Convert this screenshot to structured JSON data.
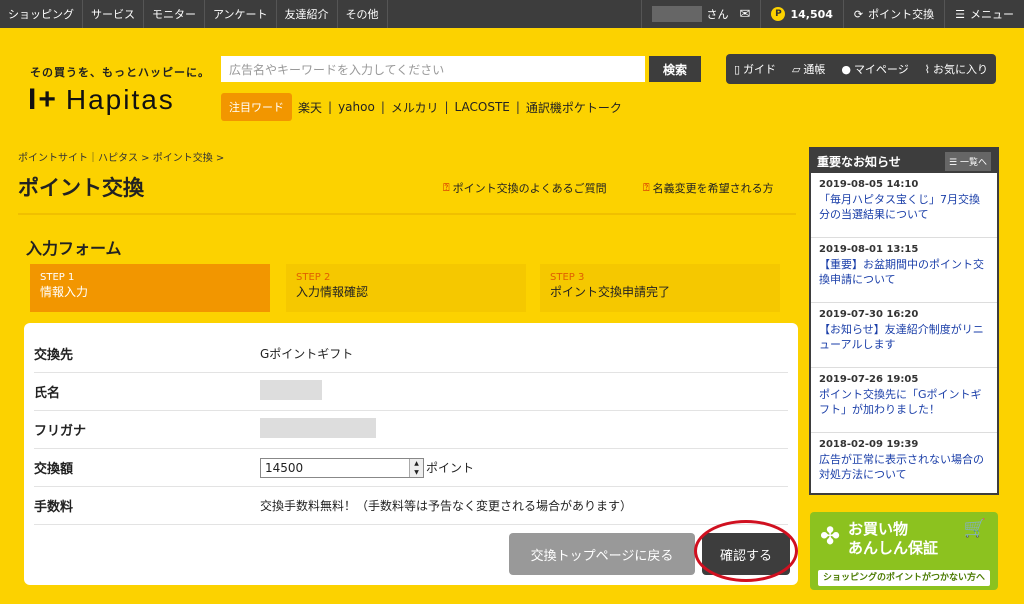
{
  "topnav": [
    "ショッピング",
    "サービス",
    "モニター",
    "アンケート",
    "友達紹介",
    "その他"
  ],
  "account": {
    "san": "さん",
    "points": "14,504",
    "exchange": "ポイント交換",
    "menu": "メニュー"
  },
  "logo": {
    "tagline": "その買うを、もっとハッピーに。",
    "name": "Hapitas"
  },
  "search": {
    "placeholder": "広告名やキーワードを入力してください",
    "button": "検索"
  },
  "toolbar": {
    "guide": "ガイド",
    "passbook": "通帳",
    "mypage": "マイページ",
    "fav": "お気に入り"
  },
  "keywords": {
    "label": "注目ワード",
    "items": [
      "楽天",
      "yahoo",
      "メルカリ",
      "LACOSTE",
      "通訳機ポケトーク"
    ]
  },
  "breadcrumb": "ポイントサイト｜ハピタス > ポイント交換 >",
  "page_title": "ポイント交換",
  "faq_link": "ポイント交換のよくあるご質問",
  "name_change_link": "名義変更を希望される方",
  "form_title": "入力フォーム",
  "steps": [
    {
      "n": "STEP 1",
      "label": "情報入力"
    },
    {
      "n": "STEP 2",
      "label": "入力情報確認"
    },
    {
      "n": "STEP 3",
      "label": "ポイント交換申請完了"
    }
  ],
  "form": {
    "dest_label": "交換先",
    "dest_value": "Gポイントギフト",
    "name_label": "氏名",
    "kana_label": "フリガナ",
    "amount_label": "交換額",
    "amount_value": "14500",
    "amount_unit": "ポイント",
    "fee_label": "手数料",
    "fee_value": "交換手数料無料！（手数料等は予告なく変更される場合があります）"
  },
  "buttons": {
    "back": "交換トップページに戻る",
    "confirm": "確認する"
  },
  "news": {
    "title": "重要なお知らせ",
    "all": "一覧へ",
    "items": [
      {
        "date": "2019-08-05 14:10",
        "text": "「毎月ハピタス宝くじ」7月交換分の当選結果について"
      },
      {
        "date": "2019-08-01 13:15",
        "text": "【重要】お盆期間中のポイント交換申請について"
      },
      {
        "date": "2019-07-30 16:20",
        "text": "【お知らせ】友達紹介制度がリニューアルします"
      },
      {
        "date": "2019-07-26 19:05",
        "text": "ポイント交換先に「Gポイントギフト」が加わりました！"
      },
      {
        "date": "2018-02-09 19:39",
        "text": "広告が正常に表示されない場合の対処方法について"
      }
    ]
  },
  "banner": {
    "line1": "お買い物",
    "line2": "あんしん保証",
    "sub": "ショッピングのポイントがつかない方へ"
  }
}
